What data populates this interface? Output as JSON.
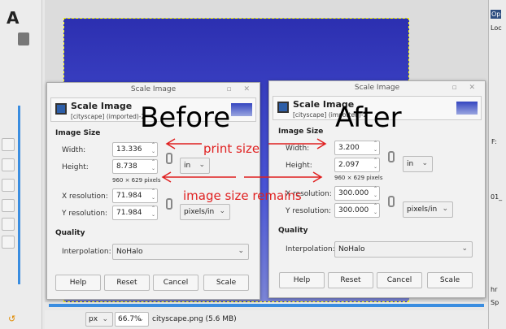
{
  "annotations": {
    "before": "Before",
    "after": "After",
    "print_size": "print size",
    "image_size_remains": "image size remains"
  },
  "dialogs": [
    {
      "window_title": "Scale Image",
      "header_title": "Scale Image",
      "header_subtitle": "[cityscape] (imported)-2",
      "image_size_label": "Image Size",
      "width_label": "Width:",
      "width": "13.336",
      "height_label": "Height:",
      "height": "8.738",
      "size_unit": "in",
      "pixels": "960 × 629 pixels",
      "xres_label": "X resolution:",
      "xres": "71.984",
      "yres_label": "Y resolution:",
      "yres": "71.984",
      "res_unit": "pixels/in",
      "quality_label": "Quality",
      "interp_label": "Interpolation:",
      "interp": "NoHalo",
      "buttons": {
        "help": "Help",
        "reset": "Reset",
        "cancel": "Cancel",
        "scale": "Scale"
      }
    },
    {
      "window_title": "Scale Image",
      "header_title": "Scale Image",
      "header_subtitle": "[cityscape] (imported)-2",
      "image_size_label": "Image Size",
      "width_label": "Width:",
      "width": "3.200",
      "height_label": "Height:",
      "height": "2.097",
      "size_unit": "in",
      "pixels": "960 × 629 pixels",
      "xres_label": "X resolution:",
      "xres": "300.000",
      "yres_label": "Y resolution:",
      "yres": "300.000",
      "res_unit": "pixels/in",
      "quality_label": "Quality",
      "interp_label": "Interpolation:",
      "interp": "NoHalo",
      "buttons": {
        "help": "Help",
        "reset": "Reset",
        "cancel": "Cancel",
        "scale": "Scale"
      }
    }
  ],
  "statusbar": {
    "unit": "px",
    "zoom": "66.7%",
    "file": "cityscape.png (5.6 MB)"
  },
  "dock": {
    "tab": "Op",
    "lock": "Loc",
    "f": "F:",
    "brush": "01_",
    "mode": "hr",
    "spacing": "Sp"
  },
  "toolbox": {
    "text_tool": "A"
  }
}
